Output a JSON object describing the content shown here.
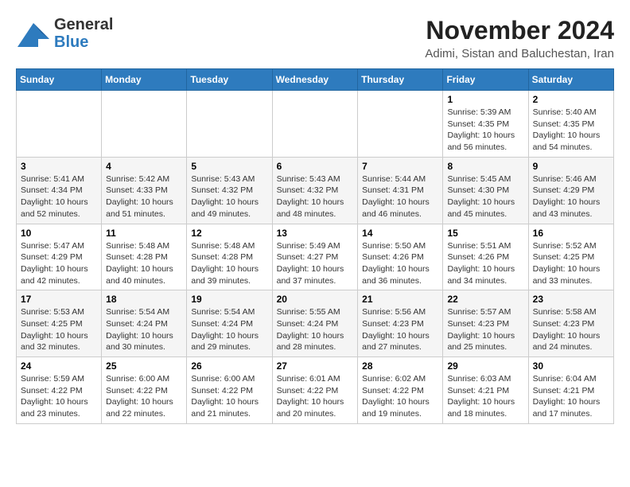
{
  "logo": {
    "line1": "General",
    "line2": "Blue"
  },
  "title": "November 2024",
  "subtitle": "Adimi, Sistan and Baluchestan, Iran",
  "calendar": {
    "days_of_week": [
      "Sunday",
      "Monday",
      "Tuesday",
      "Wednesday",
      "Thursday",
      "Friday",
      "Saturday"
    ],
    "weeks": [
      [
        {
          "day": "",
          "info": ""
        },
        {
          "day": "",
          "info": ""
        },
        {
          "day": "",
          "info": ""
        },
        {
          "day": "",
          "info": ""
        },
        {
          "day": "",
          "info": ""
        },
        {
          "day": "1",
          "info": "Sunrise: 5:39 AM\nSunset: 4:35 PM\nDaylight: 10 hours and 56 minutes."
        },
        {
          "day": "2",
          "info": "Sunrise: 5:40 AM\nSunset: 4:35 PM\nDaylight: 10 hours and 54 minutes."
        }
      ],
      [
        {
          "day": "3",
          "info": "Sunrise: 5:41 AM\nSunset: 4:34 PM\nDaylight: 10 hours and 52 minutes."
        },
        {
          "day": "4",
          "info": "Sunrise: 5:42 AM\nSunset: 4:33 PM\nDaylight: 10 hours and 51 minutes."
        },
        {
          "day": "5",
          "info": "Sunrise: 5:43 AM\nSunset: 4:32 PM\nDaylight: 10 hours and 49 minutes."
        },
        {
          "day": "6",
          "info": "Sunrise: 5:43 AM\nSunset: 4:32 PM\nDaylight: 10 hours and 48 minutes."
        },
        {
          "day": "7",
          "info": "Sunrise: 5:44 AM\nSunset: 4:31 PM\nDaylight: 10 hours and 46 minutes."
        },
        {
          "day": "8",
          "info": "Sunrise: 5:45 AM\nSunset: 4:30 PM\nDaylight: 10 hours and 45 minutes."
        },
        {
          "day": "9",
          "info": "Sunrise: 5:46 AM\nSunset: 4:29 PM\nDaylight: 10 hours and 43 minutes."
        }
      ],
      [
        {
          "day": "10",
          "info": "Sunrise: 5:47 AM\nSunset: 4:29 PM\nDaylight: 10 hours and 42 minutes."
        },
        {
          "day": "11",
          "info": "Sunrise: 5:48 AM\nSunset: 4:28 PM\nDaylight: 10 hours and 40 minutes."
        },
        {
          "day": "12",
          "info": "Sunrise: 5:48 AM\nSunset: 4:28 PM\nDaylight: 10 hours and 39 minutes."
        },
        {
          "day": "13",
          "info": "Sunrise: 5:49 AM\nSunset: 4:27 PM\nDaylight: 10 hours and 37 minutes."
        },
        {
          "day": "14",
          "info": "Sunrise: 5:50 AM\nSunset: 4:26 PM\nDaylight: 10 hours and 36 minutes."
        },
        {
          "day": "15",
          "info": "Sunrise: 5:51 AM\nSunset: 4:26 PM\nDaylight: 10 hours and 34 minutes."
        },
        {
          "day": "16",
          "info": "Sunrise: 5:52 AM\nSunset: 4:25 PM\nDaylight: 10 hours and 33 minutes."
        }
      ],
      [
        {
          "day": "17",
          "info": "Sunrise: 5:53 AM\nSunset: 4:25 PM\nDaylight: 10 hours and 32 minutes."
        },
        {
          "day": "18",
          "info": "Sunrise: 5:54 AM\nSunset: 4:24 PM\nDaylight: 10 hours and 30 minutes."
        },
        {
          "day": "19",
          "info": "Sunrise: 5:54 AM\nSunset: 4:24 PM\nDaylight: 10 hours and 29 minutes."
        },
        {
          "day": "20",
          "info": "Sunrise: 5:55 AM\nSunset: 4:24 PM\nDaylight: 10 hours and 28 minutes."
        },
        {
          "day": "21",
          "info": "Sunrise: 5:56 AM\nSunset: 4:23 PM\nDaylight: 10 hours and 27 minutes."
        },
        {
          "day": "22",
          "info": "Sunrise: 5:57 AM\nSunset: 4:23 PM\nDaylight: 10 hours and 25 minutes."
        },
        {
          "day": "23",
          "info": "Sunrise: 5:58 AM\nSunset: 4:23 PM\nDaylight: 10 hours and 24 minutes."
        }
      ],
      [
        {
          "day": "24",
          "info": "Sunrise: 5:59 AM\nSunset: 4:22 PM\nDaylight: 10 hours and 23 minutes."
        },
        {
          "day": "25",
          "info": "Sunrise: 6:00 AM\nSunset: 4:22 PM\nDaylight: 10 hours and 22 minutes."
        },
        {
          "day": "26",
          "info": "Sunrise: 6:00 AM\nSunset: 4:22 PM\nDaylight: 10 hours and 21 minutes."
        },
        {
          "day": "27",
          "info": "Sunrise: 6:01 AM\nSunset: 4:22 PM\nDaylight: 10 hours and 20 minutes."
        },
        {
          "day": "28",
          "info": "Sunrise: 6:02 AM\nSunset: 4:22 PM\nDaylight: 10 hours and 19 minutes."
        },
        {
          "day": "29",
          "info": "Sunrise: 6:03 AM\nSunset: 4:21 PM\nDaylight: 10 hours and 18 minutes."
        },
        {
          "day": "30",
          "info": "Sunrise: 6:04 AM\nSunset: 4:21 PM\nDaylight: 10 hours and 17 minutes."
        }
      ]
    ]
  }
}
